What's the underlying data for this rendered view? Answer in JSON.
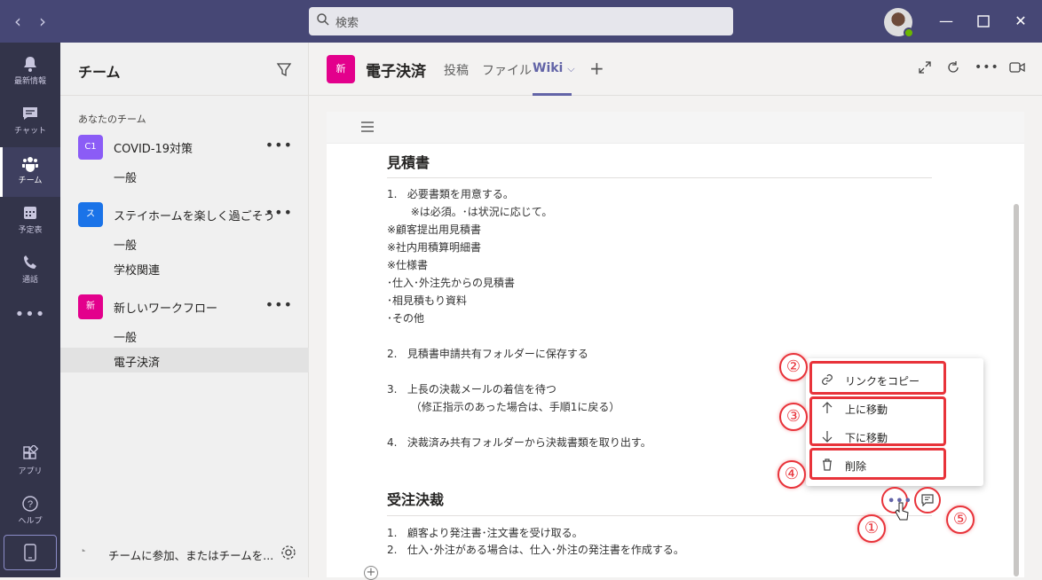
{
  "titlebar": {
    "search_placeholder": "検索"
  },
  "appbar": {
    "items": [
      {
        "label": "最新情報",
        "icon": "bell-icon"
      },
      {
        "label": "チャット",
        "icon": "chat-icon"
      },
      {
        "label": "チーム",
        "icon": "teams-icon",
        "active": true
      },
      {
        "label": "予定表",
        "icon": "calendar-icon"
      },
      {
        "label": "通話",
        "icon": "phone-icon"
      },
      {
        "label": "",
        "icon": "more-apps-icon"
      },
      {
        "label": "アプリ",
        "icon": "apps-icon"
      },
      {
        "label": "ヘルプ",
        "icon": "help-icon"
      }
    ]
  },
  "teams_panel": {
    "title": "チーム",
    "section": "あなたのチーム",
    "teams": [
      {
        "avatar": "C1",
        "name": "COVID-19対策",
        "color": "#8b5cf6",
        "channels": [
          "一般"
        ]
      },
      {
        "avatar": "ス",
        "name": "ステイホームを楽しく過ごそう",
        "color": "#1a73e8",
        "channels": [
          "一般",
          "学校関連"
        ]
      },
      {
        "avatar": "新",
        "name": "新しいワークフロー",
        "color": "#e3008c",
        "channels": [
          "一般",
          "電子決済"
        ]
      }
    ],
    "selected_channel": "電子決済",
    "join_text": "チームに参加、またはチームを..."
  },
  "header": {
    "channel_avatar": "新",
    "channel_title": "電子決済",
    "tabs": [
      "投稿",
      "ファイル",
      "Wiki"
    ],
    "active_tab": "Wiki"
  },
  "wiki": {
    "section1": {
      "title": "見積書",
      "lines": [
        "1.   必要書類を用意する。",
        "       ※は必須。･は状況に応じて。",
        "※顧客提出用見積書",
        "※社内用積算明細書",
        "※仕様書",
        "･仕入･外注先からの見積書",
        "･相見積もり資料",
        "･その他",
        "2.   見積書申請共有フォルダーに保存する",
        "3.   上長の決裁メールの着信を待つ",
        "       （修正指示のあった場合は、手順1に戻る）",
        "4.   決裁済み共有フォルダーから決裁書類を取り出す。"
      ]
    },
    "section2": {
      "title": "受注決裁",
      "lines": [
        "1.   顧客より発注書･注文書を受け取る。",
        "2.   仕入･外注がある場合は、仕入･外注の発注書を作成する。"
      ]
    }
  },
  "context_menu": {
    "copy_link": "リンクをコピー",
    "move_up": "上に移動",
    "move_down": "下に移動",
    "delete": "削除"
  },
  "annotations": {
    "n1": "①",
    "n2": "②",
    "n3": "③",
    "n4": "④",
    "n5": "⑤",
    "color": "#e8333a"
  }
}
